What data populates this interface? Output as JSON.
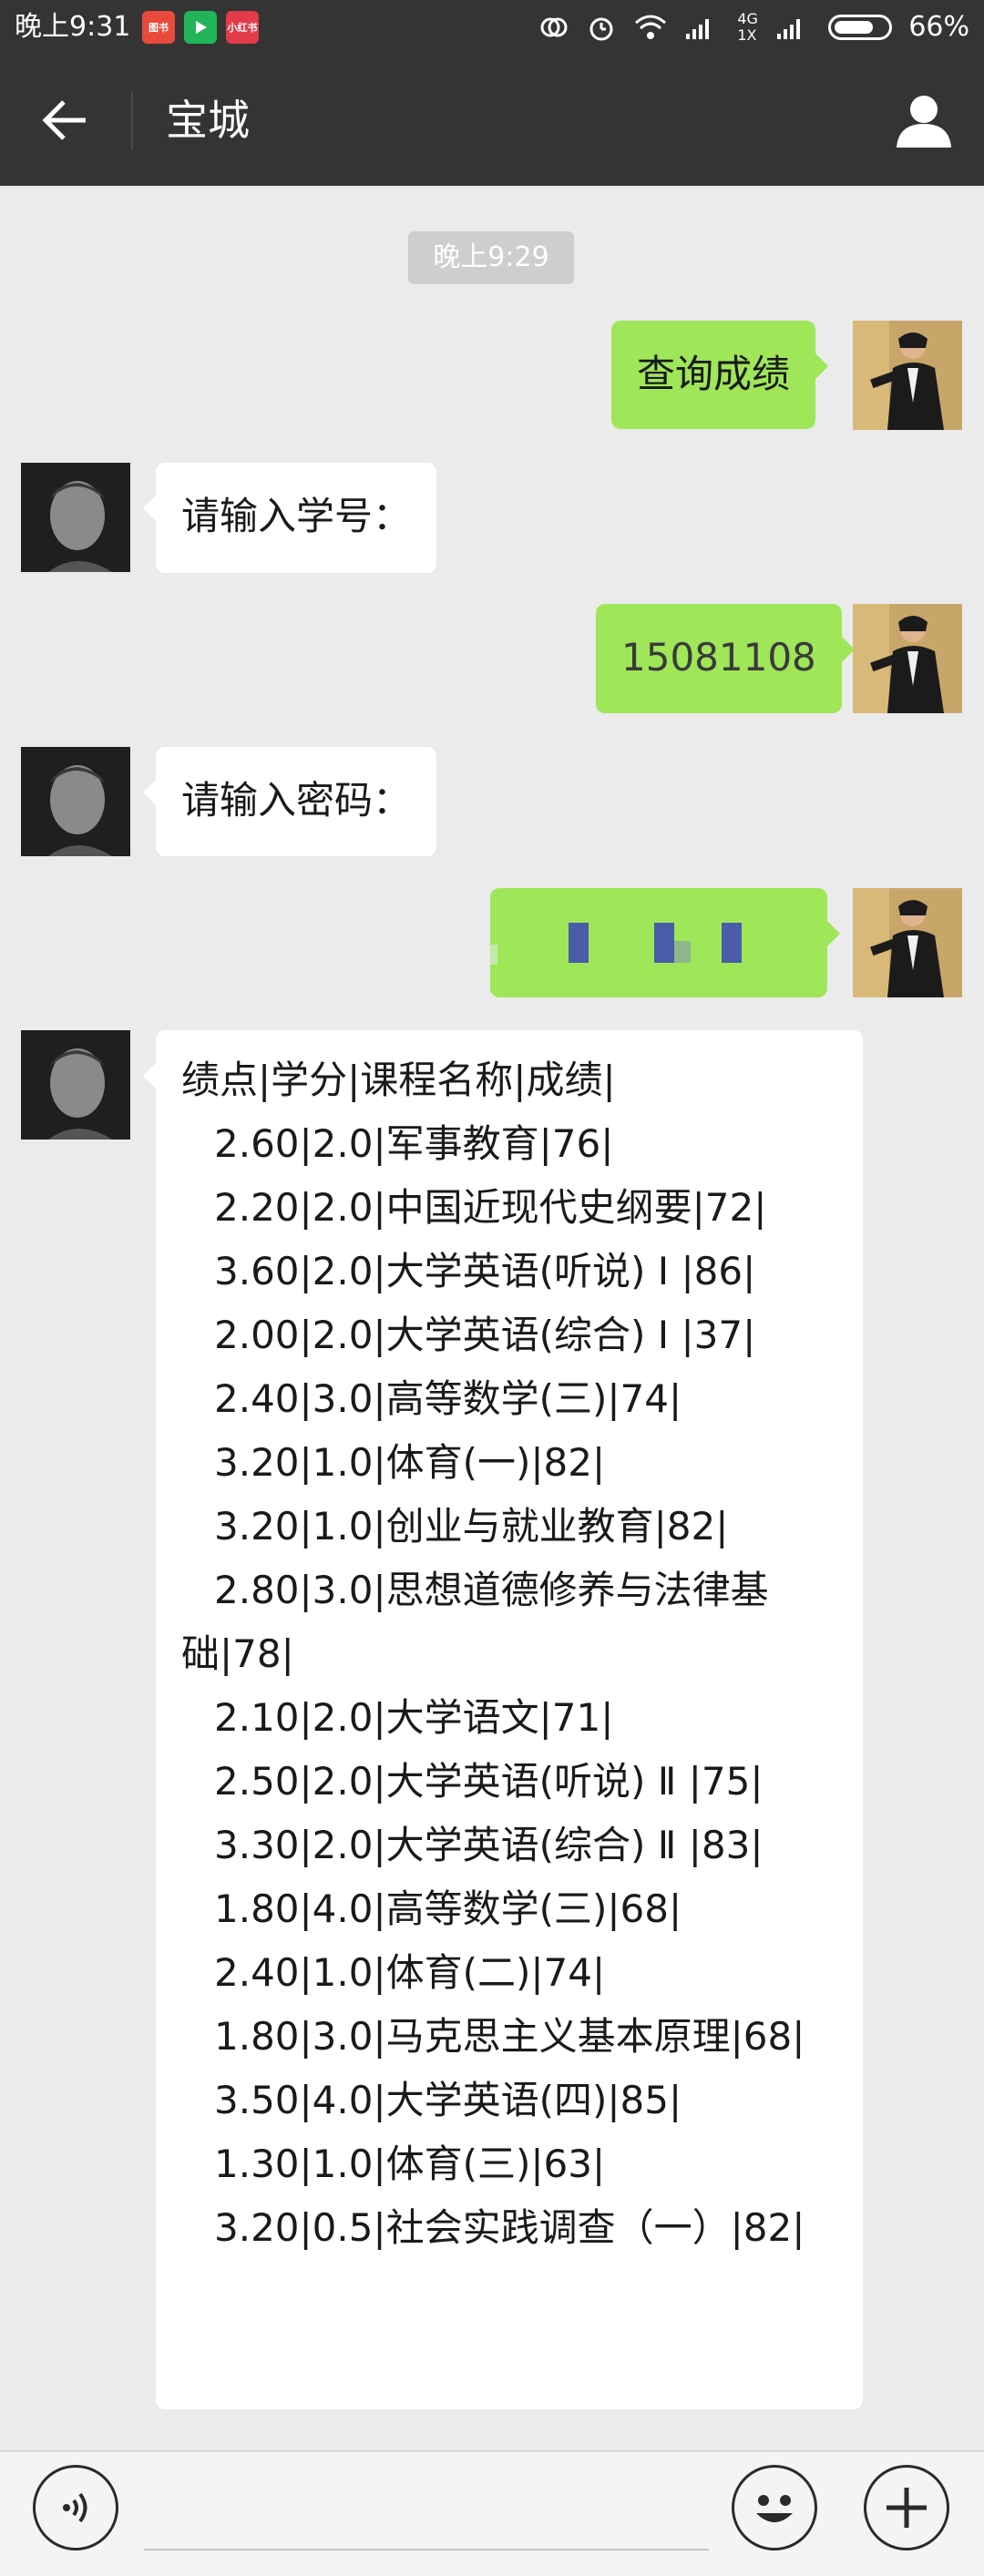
{
  "status_bar": {
    "time": "晚上9:31",
    "apps": [
      {
        "name": "图书",
        "color": "#e84a3c"
      },
      {
        "name": "play-icon",
        "color": "#21b459"
      },
      {
        "name": "小红书",
        "color": "#e23b4a"
      }
    ],
    "network": "4G 1X",
    "battery": "66%"
  },
  "navbar": {
    "title": "宝城"
  },
  "chat": {
    "timestamp": "晚上9:29",
    "messages": [
      {
        "side": "right",
        "text": "查询成绩"
      },
      {
        "side": "left",
        "text": "请输入学号："
      },
      {
        "side": "right",
        "text": "15081108"
      },
      {
        "side": "left",
        "text": "请输入密码："
      },
      {
        "side": "right",
        "text": "",
        "redacted": true
      }
    ],
    "grades": {
      "header": "绩点|学分|课程名称|成绩|",
      "rows": [
        "2.60|2.0|军事教育|76|",
        "2.20|2.0|中国近现代史纲要|72|",
        "3.60|2.0|大学英语(听说) Ⅰ |86|",
        "2.00|2.0|大学英语(综合) Ⅰ |37|",
        "2.40|3.0|高等数学(三)|74|",
        "3.20|1.0|体育(一)|82|",
        "3.20|1.0|创业与就业教育|82|",
        "2.80|3.0|思想道德修养与法律基础|78|",
        "2.10|2.0|大学语文|71|",
        "2.50|2.0|大学英语(听说) Ⅱ |75|",
        "3.30|2.0|大学英语(综合) Ⅱ |83|",
        "1.80|4.0|高等数学(三)|68|",
        "2.40|1.0|体育(二)|74|",
        "1.80|3.0|马克思主义基本原理|68|",
        "3.50|4.0|大学英语(四)|85|",
        "1.30|1.0|体育(三)|63|",
        "3.20|0.5|社会实践调查（一）|82|"
      ]
    }
  },
  "input_bar": {
    "icons": [
      "voice-icon",
      "emoji-icon",
      "plus-icon"
    ]
  },
  "colors": {
    "bar": "#343434",
    "background": "#ebebeb",
    "bubble_green": "#9fe659",
    "bubble_white": "#ffffff"
  }
}
